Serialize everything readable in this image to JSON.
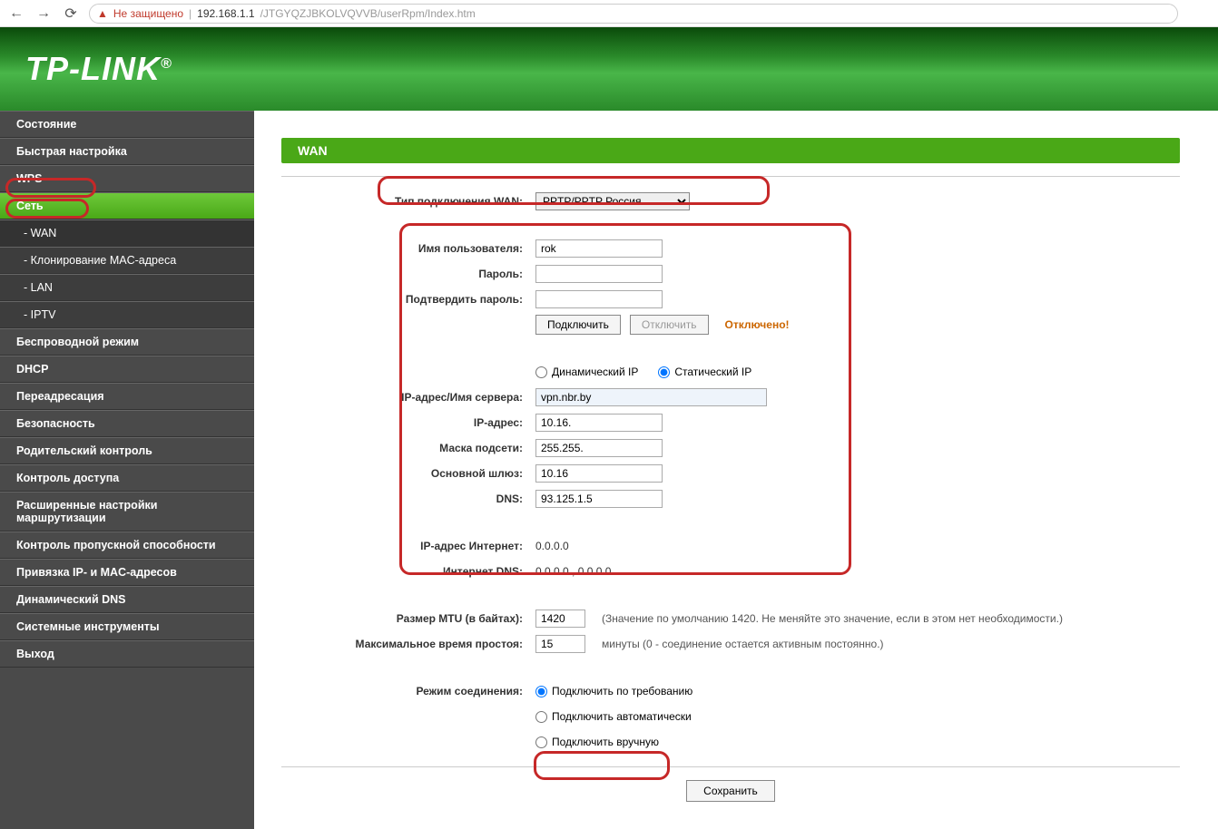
{
  "browser": {
    "not_secure": "Не защищено",
    "host": "192.168.1.1",
    "path": "/JTGYQZJBKOLVQVVB/userRpm/Index.htm"
  },
  "brand": "TP-LINK",
  "sidebar": {
    "items": [
      {
        "label": "Состояние"
      },
      {
        "label": "Быстрая настройка"
      },
      {
        "label": "WPS"
      },
      {
        "label": "Сеть",
        "active_cat": true
      },
      {
        "label": "- WAN",
        "sub": true,
        "active_sub": true
      },
      {
        "label": "- Клонирование MAC-адреса",
        "sub": true
      },
      {
        "label": "- LAN",
        "sub": true
      },
      {
        "label": "- IPTV",
        "sub": true
      },
      {
        "label": "Беспроводной режим"
      },
      {
        "label": "DHCP"
      },
      {
        "label": "Переадресация"
      },
      {
        "label": "Безопасность"
      },
      {
        "label": "Родительский контроль"
      },
      {
        "label": "Контроль доступа"
      },
      {
        "label": "Расширенные настройки маршрутизации"
      },
      {
        "label": "Контроль пропускной способности"
      },
      {
        "label": "Привязка IP- и MAC-адресов"
      },
      {
        "label": "Динамический DNS"
      },
      {
        "label": "Системные инструменты"
      },
      {
        "label": "Выход"
      }
    ]
  },
  "page": {
    "title": "WAN",
    "labels": {
      "conn_type": "Тип подключения WAN:",
      "username": "Имя пользователя:",
      "password": "Пароль:",
      "password2": "Подтвердить пароль:",
      "dyn_ip": "Динамический IP",
      "stat_ip": "Статический IP",
      "server": "IP-адрес/Имя сервера:",
      "ip": "IP-адрес:",
      "mask": "Маска подсети:",
      "gateway": "Основной шлюз:",
      "dns": "DNS:",
      "inet_ip": "IP-адрес Интернет:",
      "inet_dns": "Интернет DNS:",
      "mtu": "Размер MTU (в байтах):",
      "idle": "Максимальное время простоя:",
      "conn_mode": "Режим соединения:"
    },
    "values": {
      "conn_type": "PPTP/PPTP Россия",
      "username": "rok",
      "server": "vpn.nbr.by",
      "ip": "10.16.",
      "mask": "255.255.",
      "gateway": "10.16",
      "dns": "93.125.1.5",
      "inet_ip": "0.0.0.0",
      "inet_dns": "0.0.0.0 , 0.0.0.0",
      "mtu": "1420",
      "idle": "15"
    },
    "buttons": {
      "connect": "Подключить",
      "disconnect": "Отключить",
      "save": "Сохранить"
    },
    "status": "Отключено!",
    "hints": {
      "mtu": "(Значение по умолчанию 1420. Не меняйте это значение, если в этом нет необходимости.)",
      "idle": "минуты (0 - соединение остается активным постоянно.)"
    },
    "modes": {
      "on_demand": "Подключить по требованию",
      "auto": "Подключить автоматически",
      "manual": "Подключить вручную"
    }
  }
}
